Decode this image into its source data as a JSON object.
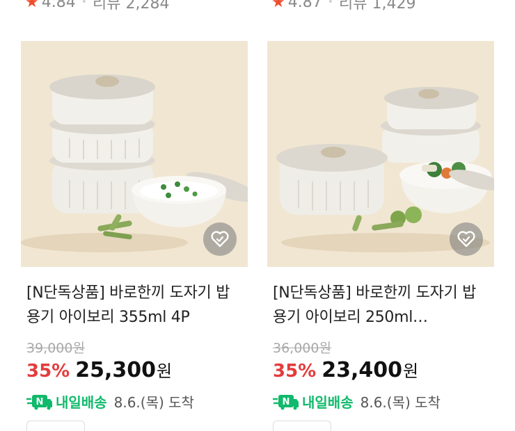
{
  "products": [
    {
      "rating": "4.84",
      "review_label": "리뷰 2,284",
      "title": "[N단독상품] 바로한끼 도자기 밥용기 아이보리 355ml 4P",
      "original_price": "39,000원",
      "discount": "35%",
      "price": "25,300",
      "currency": "원",
      "delivery_label": "내일배송",
      "delivery_date": "8.6.(목) 도착"
    },
    {
      "rating": "4.87",
      "review_label": "리뷰 1,429",
      "title": "[N단독상품] 바로한끼 도자기 밥용기 아이보리 250ml…",
      "original_price": "36,000원",
      "discount": "35%",
      "price": "23,400",
      "currency": "원",
      "delivery_label": "내일배송",
      "delivery_date": "8.6.(목) 도착"
    }
  ],
  "colors": {
    "accent_red": "#e33d3d",
    "star": "#ee4d2d",
    "delivery_green": "#10b96b",
    "image_background": "#f1e6d2"
  },
  "icons": {
    "rating": "star-icon",
    "wishlist": "heart-icon",
    "delivery": "n-delivery-truck-icon"
  }
}
